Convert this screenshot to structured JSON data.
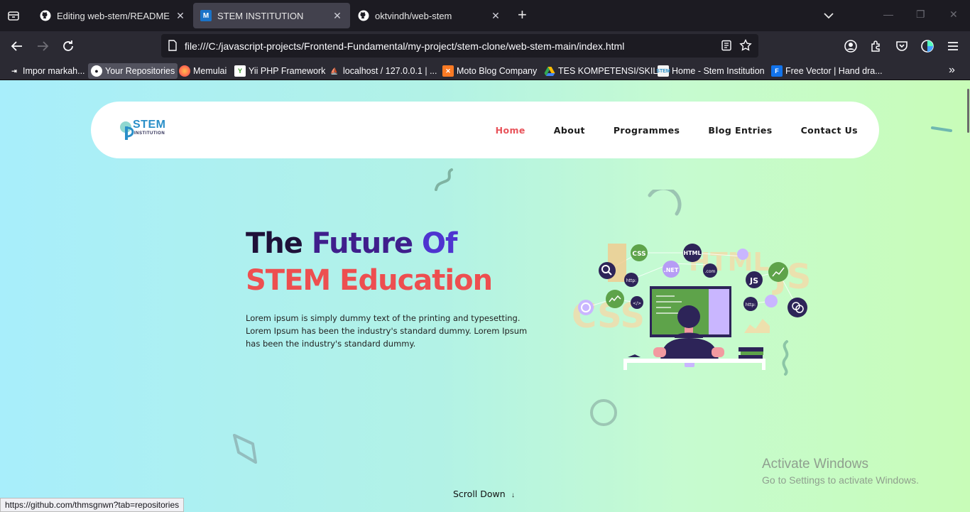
{
  "browser": {
    "tabs": [
      {
        "title": "Editing web-stem/README.md",
        "icon": "github-icon",
        "active": false
      },
      {
        "title": "STEM INSTITUTION",
        "icon": "m-favicon-icon",
        "active": true
      },
      {
        "title": "oktvindh/web-stem",
        "icon": "github-icon",
        "active": false
      }
    ],
    "url": "file:///C:/javascript-projects/Frontend-Fundamental/my-project/stem-clone/web-stem-main/index.html",
    "bookmarks": [
      {
        "label": "Impor markah...",
        "icon": "import-icon"
      },
      {
        "label": "Your Repositories",
        "icon": "github-icon"
      },
      {
        "label": "Memulai",
        "icon": "firefox-icon"
      },
      {
        "label": "Yii PHP Framework",
        "icon": "yii-icon"
      },
      {
        "label": "localhost / 127.0.0.1 | ...",
        "icon": "phpmyadmin-icon"
      },
      {
        "label": "Moto Blog Company",
        "icon": "xampp-icon"
      },
      {
        "label": "TES KOMPETENSI/SKIL...",
        "icon": "google-drive-icon"
      },
      {
        "label": "Home - Stem Institution",
        "icon": "stem-icon"
      },
      {
        "label": "Free Vector | Hand dra...",
        "icon": "freepik-icon"
      }
    ],
    "status_url": "https://github.com/thmsgnwn?tab=repositories"
  },
  "page": {
    "logo": {
      "word": "STEM",
      "sub": "INSTITUTION"
    },
    "nav": [
      "Home",
      "About",
      "Programmes",
      "Blog Entries",
      "Contact Us"
    ],
    "hero": {
      "title_part1": "The ",
      "title_part2": "Future ",
      "title_part3": "Of",
      "title_line2": "STEM Education",
      "description": "Lorem ipsum is simply dummy text of the printing and typesetting. Lorem Ipsum has been the industry's standard dummy. Lorem Ipsum has been the industry's standard dummy."
    },
    "scroll_down": "Scroll Down",
    "scroll_arrow": "↓",
    "illustration_labels": [
      "CSS",
      "HTML",
      ".NET",
      ".com",
      "JS",
      "http:",
      "</>"
    ],
    "colors": {
      "accent": "#e8535a",
      "title_dark": "#1f1139",
      "title_purple": "#4e34d0",
      "title_red": "#ed4f50"
    }
  },
  "os": {
    "activate_title": "Activate Windows",
    "activate_sub": "Go to Settings to activate Windows."
  }
}
